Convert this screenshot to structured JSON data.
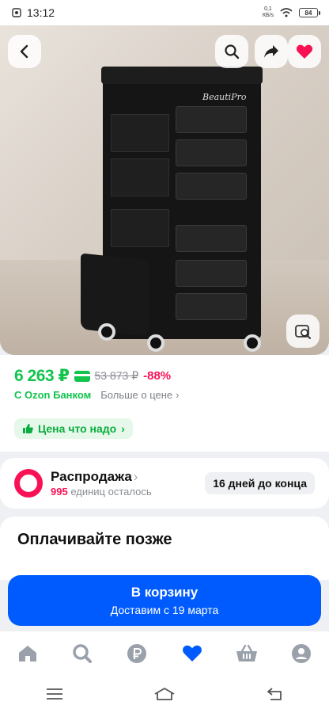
{
  "status": {
    "time": "13:12",
    "speed": "0,1",
    "speed_unit": "КБ/s",
    "battery": "84"
  },
  "product": {
    "brand_mark": "BeautiPro"
  },
  "price": {
    "current": "6 263 ₽",
    "old": "53 873 ₽",
    "discount": "-88%",
    "bank": "С Ozon Банком",
    "more": "Больше о цене",
    "good_price": "Цена что надо"
  },
  "sale": {
    "title": "Распродажа",
    "count": "995",
    "count_suffix": " единиц осталось",
    "days_left": "16 дней до конца"
  },
  "pay_later": {
    "title": "Оплачивайте позже"
  },
  "cta": {
    "label": "В корзину",
    "sub": "Доставим с 19 марта"
  },
  "colors": {
    "accent": "#005bff",
    "price": "#10c44c",
    "sale": "#f91155"
  },
  "nav": [
    "home-icon",
    "search-icon",
    "ruble-icon",
    "heart-icon",
    "basket-icon",
    "profile-icon"
  ]
}
